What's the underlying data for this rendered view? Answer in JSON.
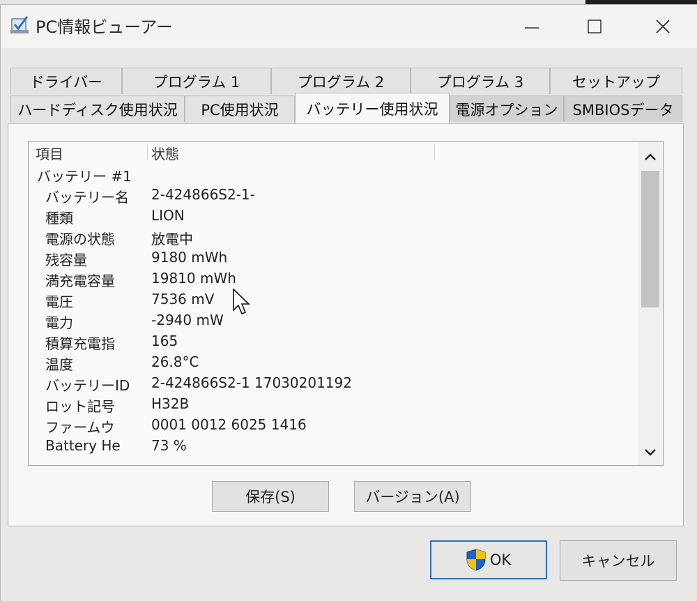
{
  "window": {
    "title": "PC情報ビューアー"
  },
  "tabs": {
    "row1": [
      {
        "label": "ドライバー"
      },
      {
        "label": "プログラム 1"
      },
      {
        "label": "プログラム 2"
      },
      {
        "label": "プログラム 3"
      },
      {
        "label": "セットアップ"
      }
    ],
    "row2": [
      {
        "label": "ハードディスク使用状況"
      },
      {
        "label": "PC使用状況"
      },
      {
        "label": "バッテリー使用状況",
        "active": true
      },
      {
        "label": "電源オプション"
      },
      {
        "label": "SMBIOSデータ"
      }
    ]
  },
  "list": {
    "columns": [
      "項目",
      "状態"
    ],
    "group": "バッテリー #1",
    "rows": [
      {
        "k": "バッテリー名",
        "v": "2-424866S2-1-"
      },
      {
        "k": "種類",
        "v": "LION"
      },
      {
        "k": "電源の状態",
        "v": "放電中"
      },
      {
        "k": "残容量",
        "v": "9180 mWh"
      },
      {
        "k": "満充電容量",
        "v": "19810 mWh"
      },
      {
        "k": "電圧",
        "v": "7536 mV"
      },
      {
        "k": "電力",
        "v": "-2940 mW"
      },
      {
        "k": "積算充電指",
        "v": "165"
      },
      {
        "k": "温度",
        "v": "26.8°C"
      },
      {
        "k": "バッテリーID",
        "v": "2-424866S2-1  17030201192"
      },
      {
        "k": "ロット記号",
        "v": "H32B"
      },
      {
        "k": "ファームウ",
        "v": "0001 0012 6025 1416"
      },
      {
        "k": "Battery He",
        "v": "73 %"
      }
    ],
    "scroll_position": 0.15
  },
  "buttons": {
    "save": "保存(S)",
    "version": "バージョン(A)",
    "ok": "OK",
    "cancel": "キャンセル"
  },
  "icons": {
    "app": "checklist-icon",
    "shield": "uac-shield-icon"
  }
}
